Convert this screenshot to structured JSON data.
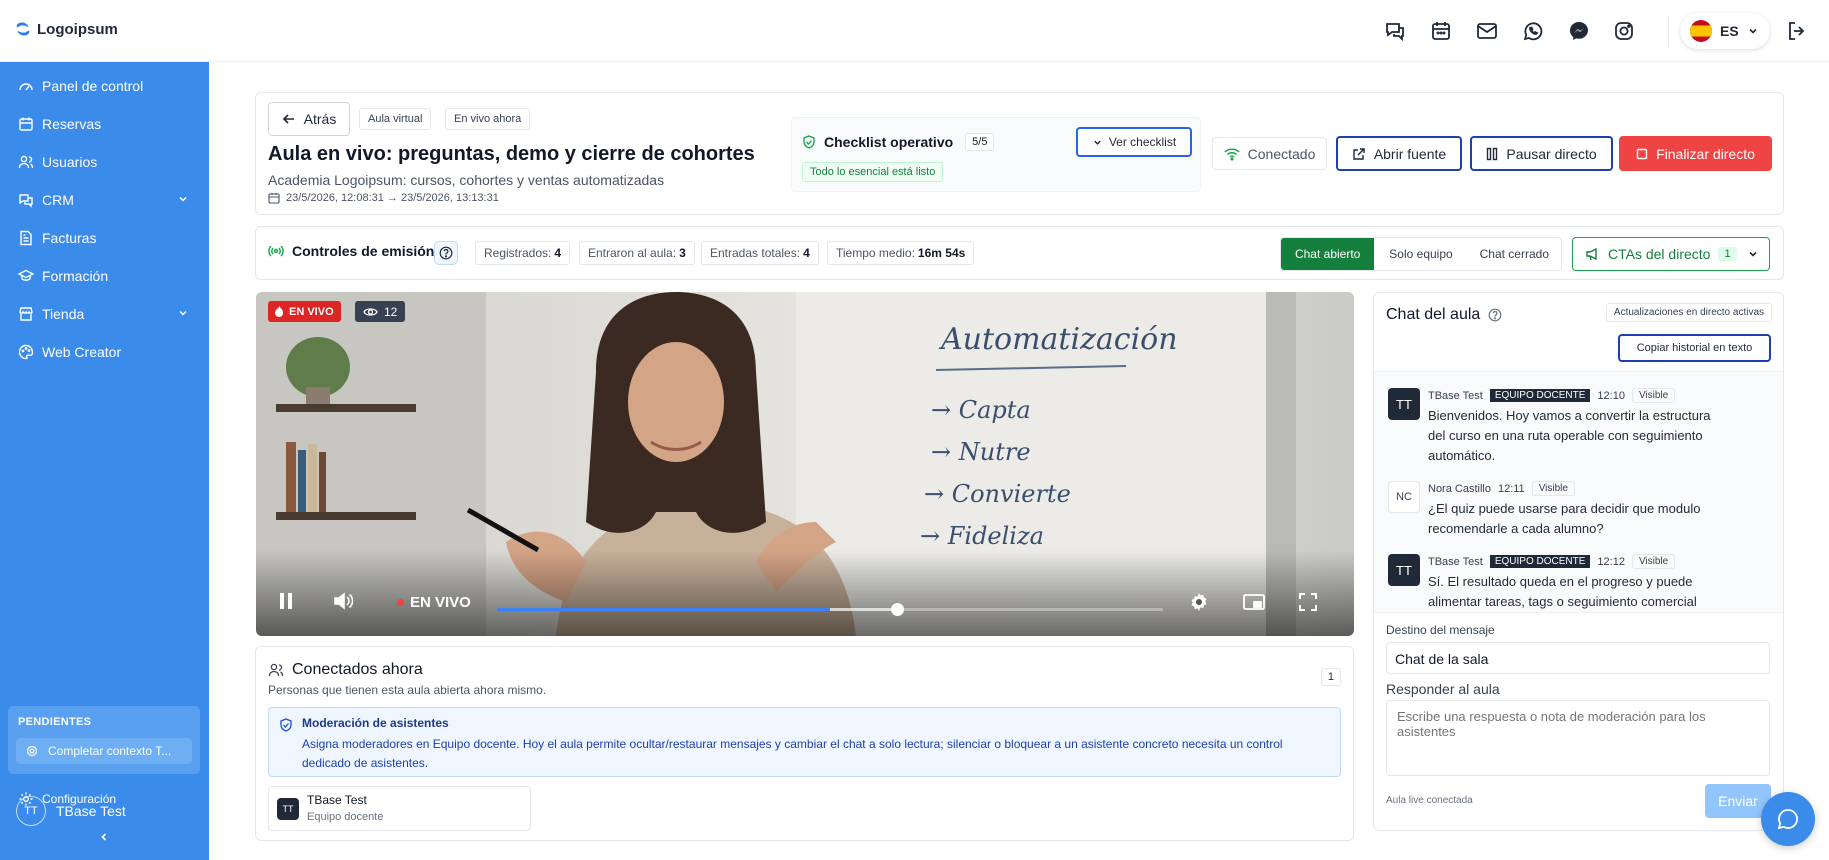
{
  "brand": {
    "name": "Logoipsum"
  },
  "topbar": {
    "lang": "ES"
  },
  "sidebar": {
    "items": [
      {
        "label": "Panel de control",
        "icon": "gauge-icon"
      },
      {
        "label": "Reservas",
        "icon": "calendar-icon"
      },
      {
        "label": "Usuarios",
        "icon": "users-icon"
      },
      {
        "label": "CRM",
        "icon": "crm-icon"
      },
      {
        "label": "Facturas",
        "icon": "invoice-icon"
      },
      {
        "label": "Formación",
        "icon": "graduation-icon"
      },
      {
        "label": "Tienda",
        "icon": "store-icon"
      },
      {
        "label": "Web Creator",
        "icon": "palette-icon"
      }
    ],
    "pending_title": "PENDIENTES",
    "pending_item": "Completar contexto T...",
    "user_initials": "TT",
    "user_name": "TBase Test",
    "settings": "Configuración"
  },
  "header": {
    "back": "Atrás",
    "tag1": "Aula virtual",
    "tag2": "En vivo ahora",
    "title": "Aula en vivo: preguntas, demo y cierre de cohortes",
    "subtitle": "Academia Logoipsum: cursos, cohortes y ventas automatizadas",
    "dates": "23/5/2026, 12:08:31 → 23/5/2026, 13:13:31",
    "checklist_label": "Checklist operativo",
    "checklist_count": "5/5",
    "checklist_status": "Todo lo esencial está listo",
    "checklist_button": "Ver checklist",
    "connected": "Conectado",
    "open_source": "Abrir fuente",
    "pause": "Pausar directo",
    "finish": "Finalizar directo"
  },
  "controls": {
    "title": "Controles de emisión",
    "stats": [
      {
        "label": "Registrados:",
        "value": "4"
      },
      {
        "label": "Entraron al aula:",
        "value": "3"
      },
      {
        "label": "Entradas totales:",
        "value": "4"
      },
      {
        "label": "Tiempo medio:",
        "value": "16m 54s"
      }
    ],
    "chat_modes": [
      "Chat abierto",
      "Solo equipo",
      "Chat cerrado"
    ],
    "ctas_label": "CTAs del directo",
    "ctas_count": "1"
  },
  "video": {
    "live_badge": "EN VIVO",
    "viewers": "12",
    "live_control": "EN VIVO",
    "progress": 0.6,
    "buffered": 0.5,
    "board": {
      "title": "Automatización",
      "items": [
        "→ Capta",
        "→ Nutre",
        "→ Convierte",
        "→ Fideliza"
      ]
    }
  },
  "connected": {
    "title": "Conectados ahora",
    "subtitle": "Personas que tienen esta aula abierta ahora mismo.",
    "count": "1",
    "moderation_title": "Moderación de asistentes",
    "moderation_text": "Asigna moderadores en Equipo docente. Hoy el aula permite ocultar/restaurar mensajes y cambiar el chat a solo lectura; silenciar o bloquear a un asistente concreto necesita un control dedicado de asistentes.",
    "person_initials": "TT",
    "person_name": "TBase Test",
    "person_role": "Equipo docente"
  },
  "chat": {
    "title": "Chat del aula",
    "live_updates": "Actualizaciones en directo activas",
    "copy_history": "Copiar historial en texto",
    "messages": [
      {
        "initials": "TT",
        "author": "TBase Test",
        "badge": "EQUIPO DOCENTE",
        "time": "12:10",
        "visibility": "Visible",
        "text": "Bienvenidos. Hoy vamos a convertir la estructura del curso en una ruta operable con seguimiento automático."
      },
      {
        "initials": "NC",
        "author": "Nora Castillo",
        "badge": "",
        "time": "12:11",
        "visibility": "Visible",
        "text": "¿El quiz puede usarse para decidir que modulo recomendarle a cada alumno?"
      },
      {
        "initials": "TT",
        "author": "TBase Test",
        "badge": "EQUIPO DOCENTE",
        "time": "12:12",
        "visibility": "Visible",
        "text": "Sí. El resultado queda en el progreso y puede alimentar tareas, tags o seguimiento comercial"
      }
    ],
    "dest_label": "Destino del mensaje",
    "dest_value": "Chat de la sala",
    "reply_label": "Responder al aula",
    "reply_placeholder": "Escribe una respuesta o nota de moderación para los asistentes",
    "status": "Aula live conectada",
    "send": "Enviar"
  },
  "colors": {
    "sidebar": "#3b8beb",
    "accent": "#2563eb",
    "danger": "#ef4444",
    "success": "#16a34a"
  }
}
